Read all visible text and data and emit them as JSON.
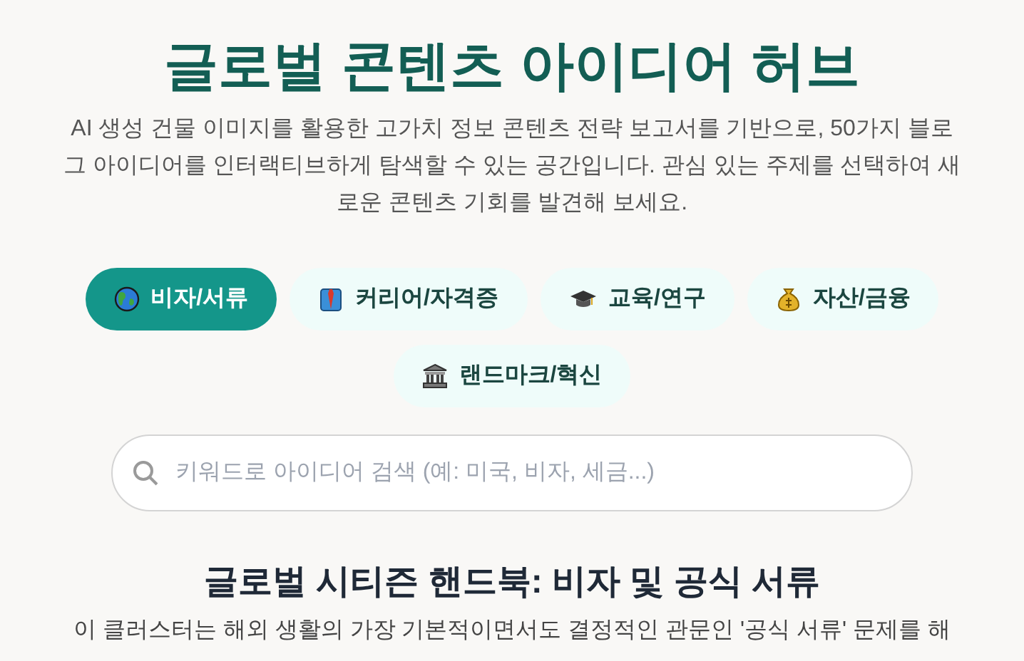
{
  "title": "글로벌 콘텐츠 아이디어 허브",
  "description": "AI 생성 건물 이미지를 활용한 고가치 정보 콘텐츠 전략 보고서를 기반으로, 50가지 블로그 아이디어를 인터랙티브하게 탐색할 수 있는 공간입니다. 관심 있는 주제를 선택하여 새로운 콘텐츠 기회를 발견해 보세요.",
  "tabs": [
    {
      "label": "비자/서류",
      "kind": "globe",
      "selected": true
    },
    {
      "label": "커리어/자격증",
      "kind": "shirt",
      "selected": false
    },
    {
      "label": "교육/연구",
      "kind": "cap",
      "selected": false
    },
    {
      "label": "자산/금융",
      "kind": "money",
      "selected": false
    },
    {
      "label": "랜드마크/혁신",
      "kind": "bank",
      "selected": false
    }
  ],
  "search": {
    "placeholder": "키워드로 아이디어 검색 (예: 미국, 비자, 세금...)"
  },
  "section": {
    "heading": "글로벌 시티즌 핸드북: 비자 및 공식 서류",
    "text": "이 클러스터는 해외 생활의 가장 기본적이면서도 결정적인 관문인 '공식 서류' 문제를 해"
  }
}
